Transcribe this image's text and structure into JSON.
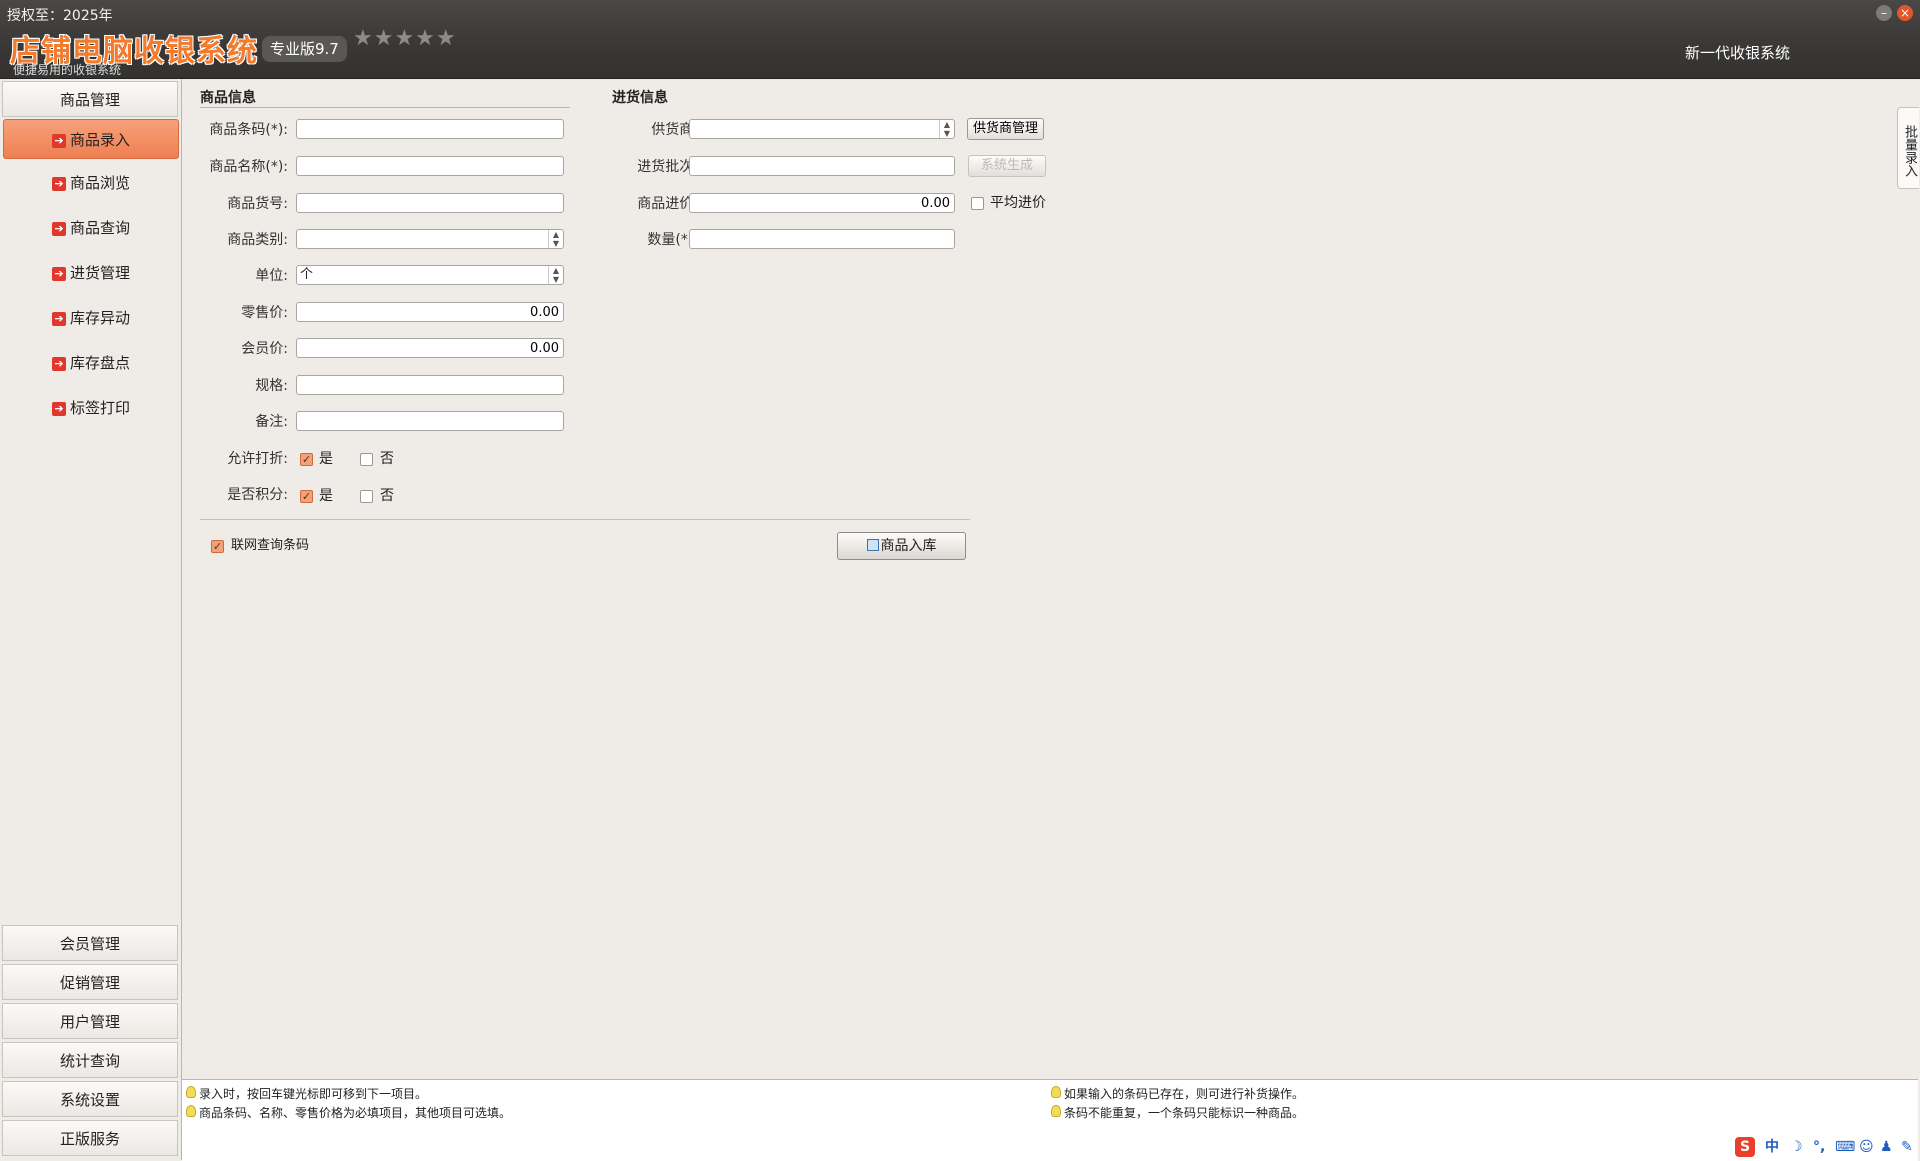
{
  "header": {
    "license": "授权至：2025年",
    "title": "店铺电脑收银系统",
    "subtitle": "便捷易用的收银系统",
    "edition": "专业版9.7",
    "stars": "★★★★★",
    "right_text": "新一代收银系统",
    "min_glyph": "–",
    "close_glyph": "×"
  },
  "sidebar": {
    "top_group": "商品管理",
    "items": [
      {
        "label": "商品录入",
        "active": true
      },
      {
        "label": "商品浏览"
      },
      {
        "label": "商品查询"
      },
      {
        "label": "进货管理"
      },
      {
        "label": "库存异动"
      },
      {
        "label": "库存盘点"
      },
      {
        "label": "标签打印"
      }
    ],
    "bottom_groups": [
      "会员管理",
      "促销管理",
      "用户管理",
      "统计查询",
      "系统设置",
      "正版服务"
    ]
  },
  "product_info": {
    "title": "商品信息",
    "barcode_label": "商品条码(*):",
    "barcode_value": "",
    "name_label": "商品名称(*):",
    "name_value": "",
    "sku_label": "商品货号:",
    "sku_value": "",
    "category_label": "商品类别:",
    "category_value": "",
    "unit_label": "单位:",
    "unit_value": "个",
    "retail_price_label": "零售价:",
    "retail_price_value": "0.00",
    "member_price_label": "会员价:",
    "member_price_value": "0.00",
    "spec_label": "规格:",
    "spec_value": "",
    "note_label": "备注:",
    "note_value": "",
    "discount_label": "允许打折:",
    "points_label": "是否积分:",
    "yes": "是",
    "no": "否",
    "discount_allowed": true,
    "points_enabled": true
  },
  "purchase_info": {
    "title": "进货信息",
    "supplier_label": "供货商:",
    "supplier_value": "",
    "supplier_mgmt_button": "供货商管理",
    "batch_label": "进货批次:",
    "batch_value": "",
    "generate_button": "系统生成",
    "cost_label": "商品进价:",
    "cost_value": "0.00",
    "avg_cost_label": "平均进价",
    "avg_cost_checked": false,
    "qty_label": "数量(*):",
    "qty_value": ""
  },
  "footer": {
    "online_lookup_label": "联网查询条码",
    "online_lookup_checked": true,
    "stock_in_button": "商品入库"
  },
  "side_tab": "批量录入",
  "tips": [
    "录入时，按回车键光标即可移到下一项目。",
    "商品条码、名称、零售价格为必填项目，其他项目可选填。",
    "如果输入的条码已存在，则可进行补货操作。",
    "条码不能重复，一个条码只能标识一种商品。"
  ],
  "tray": {
    "ime_logo": "S",
    "ime_mode": "中",
    "moon": "☽",
    "punct": "°,",
    "keyboard": "⌨",
    "user": "☺",
    "skin": "♟",
    "tool": "✎"
  },
  "colors": {
    "accent": "#ee7f52",
    "header_bg": "#3a3836",
    "title_orange": "#f47a2c",
    "close_red": "#e3552a"
  }
}
